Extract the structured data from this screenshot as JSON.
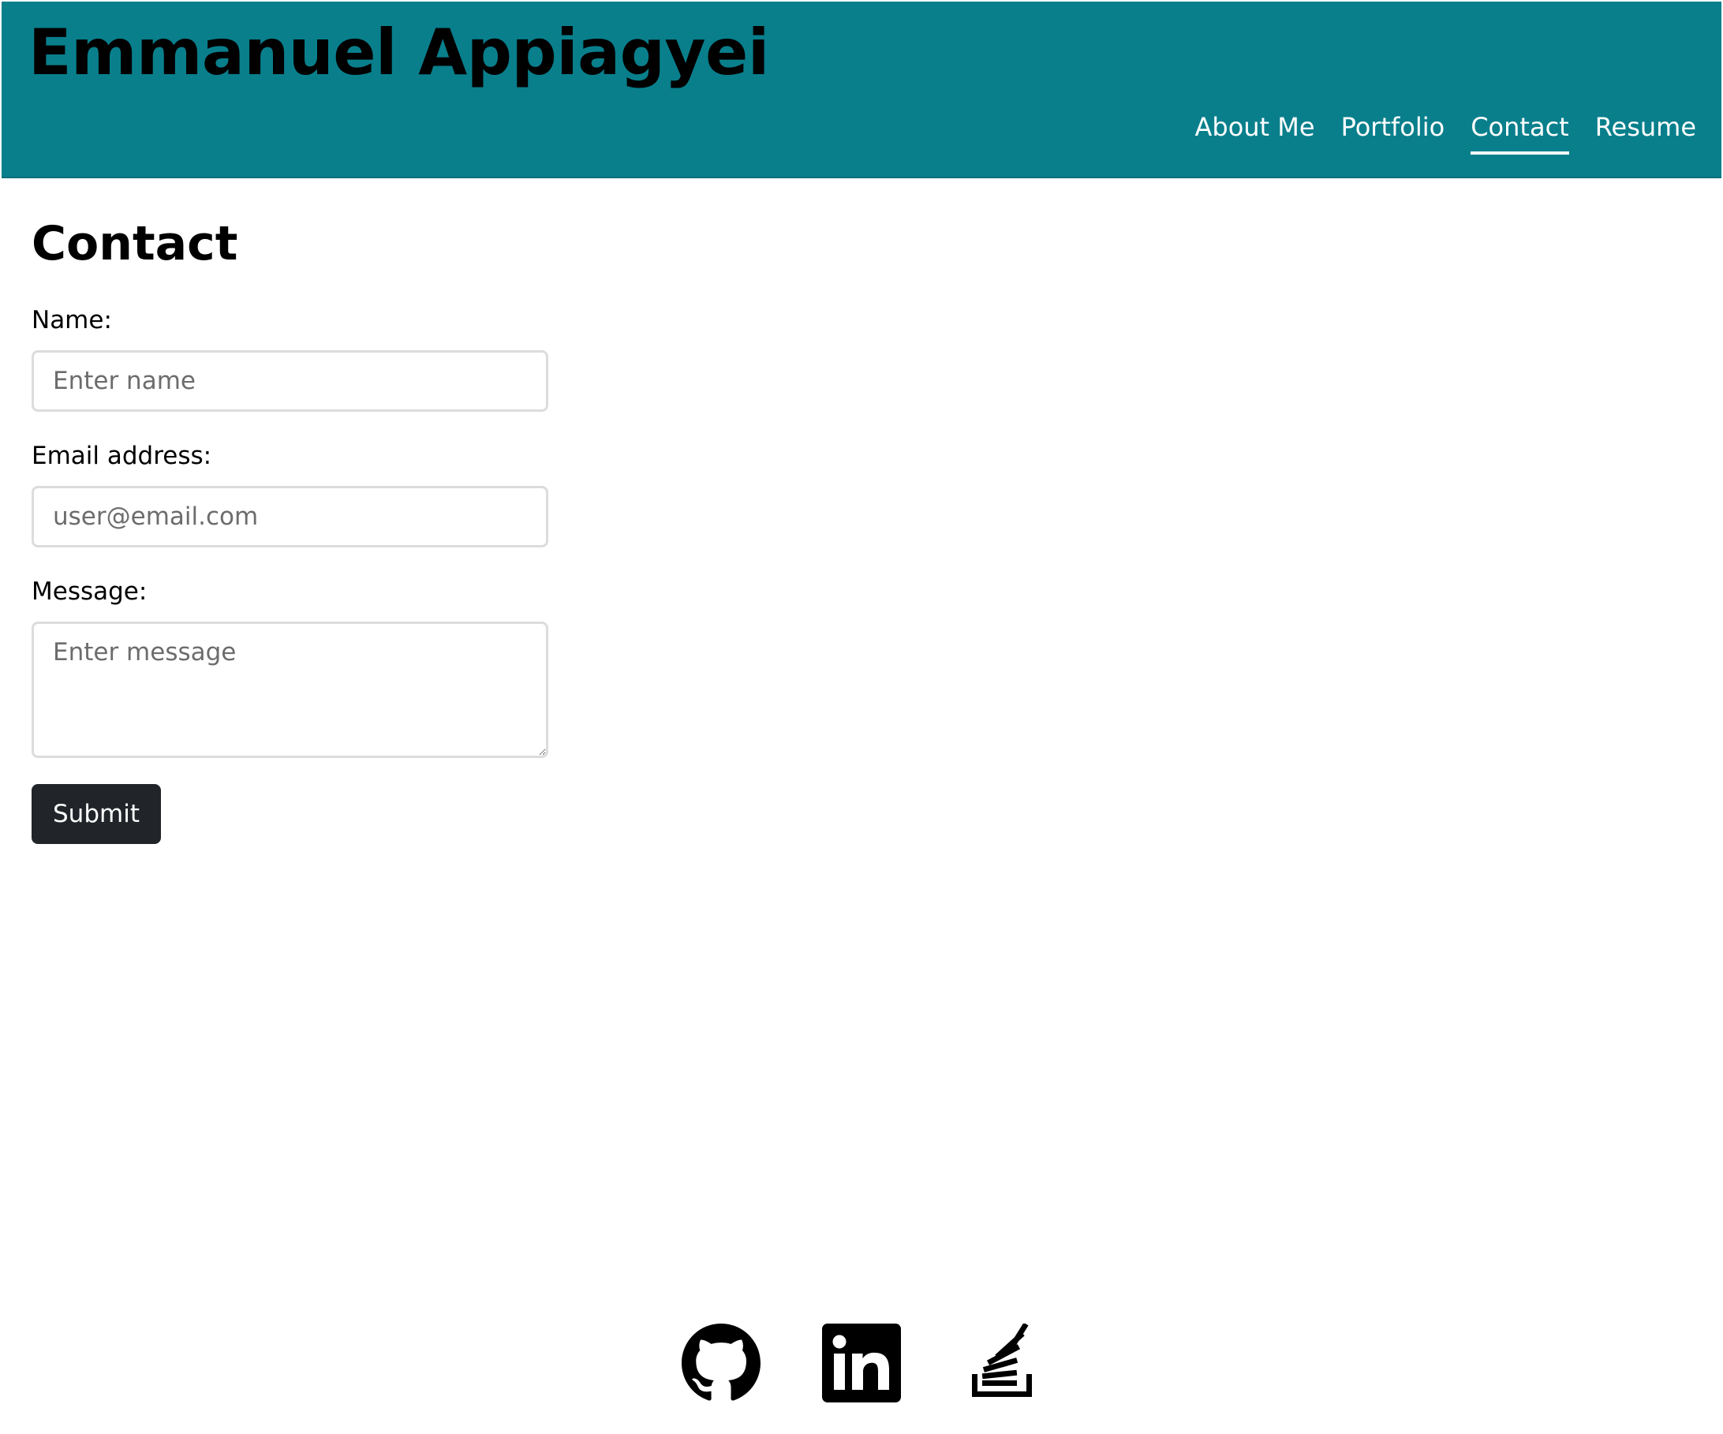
{
  "header": {
    "site_title": "Emmanuel Appiagyei",
    "background_color": "#097f8c",
    "nav": [
      {
        "label": "About Me",
        "active": false
      },
      {
        "label": "Portfolio",
        "active": false
      },
      {
        "label": "Contact",
        "active": true
      },
      {
        "label": "Resume",
        "active": false
      }
    ]
  },
  "main": {
    "title": "Contact",
    "form": {
      "name_label": "Name:",
      "name_value": "",
      "name_placeholder": "Enter name",
      "email_label": "Email address:",
      "email_value": "",
      "email_placeholder": "user@email.com",
      "message_label": "Message:",
      "message_value": "",
      "message_placeholder": "Enter message",
      "submit_label": "Submit",
      "submit_color": "#212529"
    }
  },
  "footer": {
    "icons": [
      "github-icon",
      "linkedin-icon",
      "stackoverflow-icon"
    ]
  }
}
